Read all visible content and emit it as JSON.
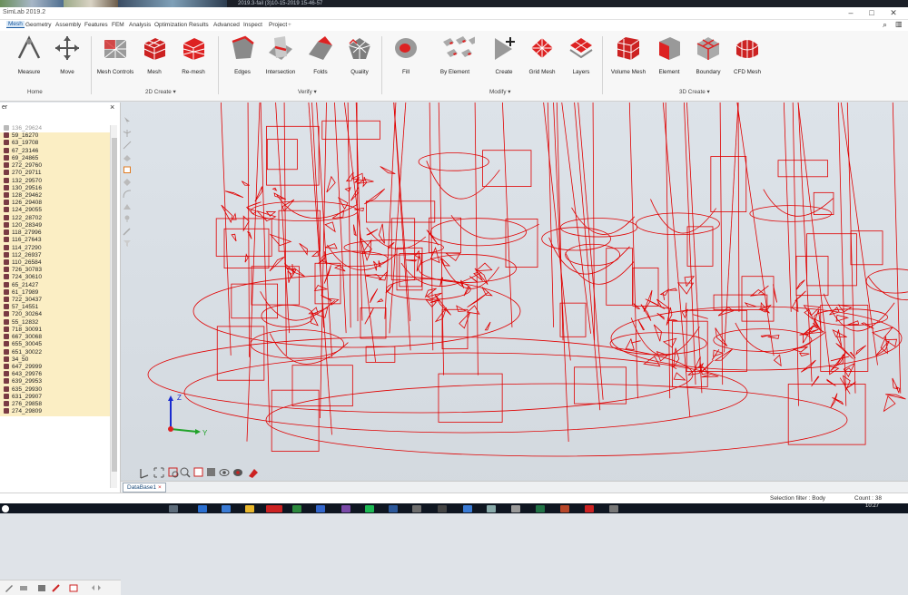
{
  "window": {
    "title": "SimLab 2019.2",
    "doc_title": "2019.3-fail (3)10-15-2019 15-46-57"
  },
  "menus": [
    "Mesh",
    "Geometry",
    "Assembly",
    "Features",
    "FEM",
    "Analysis",
    "Optimization",
    "Results",
    "Advanced",
    "Inspect",
    "Project"
  ],
  "active_menu": "Mesh",
  "ribbon": {
    "tools": {
      "measure": "Measure",
      "move": "Move",
      "mesh_controls": "Mesh Controls",
      "mesh": "Mesh",
      "remesh": "Re-mesh",
      "edges": "Edges",
      "intersection": "Intersection",
      "folds": "Folds",
      "quality": "Quality",
      "fill": "Fill",
      "by_element": "By Element",
      "create": "Create",
      "grid_mesh": "Grid Mesh",
      "layers": "Layers",
      "volume_mesh": "Volume Mesh",
      "element": "Element",
      "boundary": "Boundary",
      "cfd_mesh": "CFD Mesh"
    },
    "groups": {
      "home": "Home",
      "create_2d": "2D Create",
      "verify": "Verify",
      "modify": "Modify",
      "create_3d": "3D Create"
    }
  },
  "panel": {
    "header": "er",
    "items": [
      "136_29624",
      "59_16270",
      "63_19708",
      "67_23146",
      "69_24865",
      "272_29760",
      "270_29711",
      "132_29570",
      "130_29516",
      "128_29462",
      "126_29408",
      "124_29055",
      "122_28702",
      "120_28349",
      "118_27996",
      "116_27643",
      "114_27290",
      "112_26937",
      "110_26584",
      "726_30783",
      "724_30610",
      "65_21427",
      "61_17989",
      "722_30437",
      "57_14551",
      "720_30264",
      "55_12832",
      "718_30091",
      "667_30068",
      "655_30045",
      "651_30022",
      "34_50",
      "647_29999",
      "643_29976",
      "639_29953",
      "635_29930",
      "631_29907",
      "276_29858",
      "274_29809"
    ]
  },
  "viewport": {
    "tab_label": "DataBase1",
    "axis": {
      "z": "Z",
      "y": "Y"
    }
  },
  "status": {
    "selection_filter": "Selection filter : Body",
    "count": "Count : 38"
  },
  "taskbar": {
    "time": "10:27"
  },
  "colors": {
    "wire": "#e00000",
    "accent": "#1a5aa0",
    "item_bg": "#fbeec4",
    "body_icon": "#7a3b44"
  }
}
